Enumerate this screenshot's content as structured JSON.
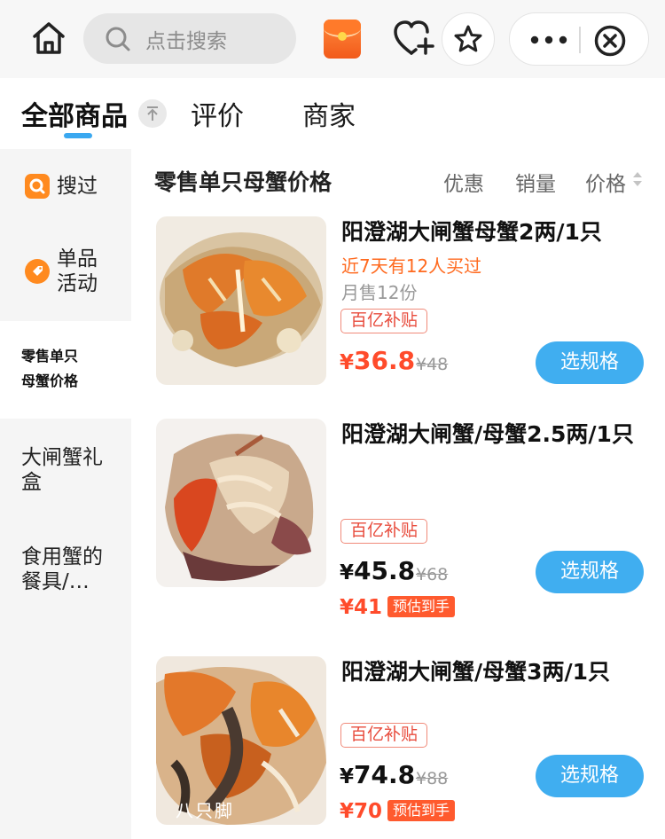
{
  "topbar": {
    "search_placeholder": "点击搜索",
    "icons": [
      "home-icon",
      "search-icon",
      "red-packet-icon",
      "heart-plus-icon",
      "star-icon",
      "more-icon",
      "close-icon"
    ]
  },
  "tabs": [
    {
      "label": "全部商品",
      "active": true
    },
    {
      "label": "评价",
      "active": false
    },
    {
      "label": "商家",
      "active": false
    }
  ],
  "sidebar": {
    "items": [
      {
        "label": "搜过"
      },
      {
        "line1": "单品",
        "line2": "活动"
      },
      {
        "line1": "零售单只",
        "line2": "母蟹价格",
        "active": true
      },
      {
        "line1": "大闸蟹礼",
        "line2": "盒"
      },
      {
        "line1": "食用蟹的",
        "line2": "餐具/…"
      }
    ]
  },
  "section": {
    "title": "零售单只母蟹价格",
    "sort": [
      "优惠",
      "销量",
      "价格"
    ]
  },
  "products": [
    {
      "name": "阳澄湖大闸蟹母蟹2两/1只",
      "recent_buyers": "近7天有12人买过",
      "monthly_sales": "月售12份",
      "tag": "百亿补贴",
      "price_symbol": "¥",
      "price": "36.8",
      "original_price": "¥48",
      "button": "选规格"
    },
    {
      "name": "阳澄湖大闸蟹/母蟹2.5两/1只",
      "tag": "百亿补贴",
      "price_symbol": "¥",
      "price": "45.8",
      "original_price": "¥68",
      "estimated_price": "¥41",
      "estimated_label": "预估到手",
      "button": "选规格"
    },
    {
      "name": "阳澄湖大闸蟹/母蟹3两/1只",
      "tag": "百亿补贴",
      "price_symbol": "¥",
      "price": "74.8",
      "original_price": "¥88",
      "estimated_price": "¥70",
      "estimated_label": "预估到手",
      "button": "选规格",
      "watermark": "八只脚"
    }
  ],
  "colors": {
    "accent_blue": "#40aef0",
    "price_red": "#ff4b2b",
    "recent_orange": "#ff6a1f"
  }
}
